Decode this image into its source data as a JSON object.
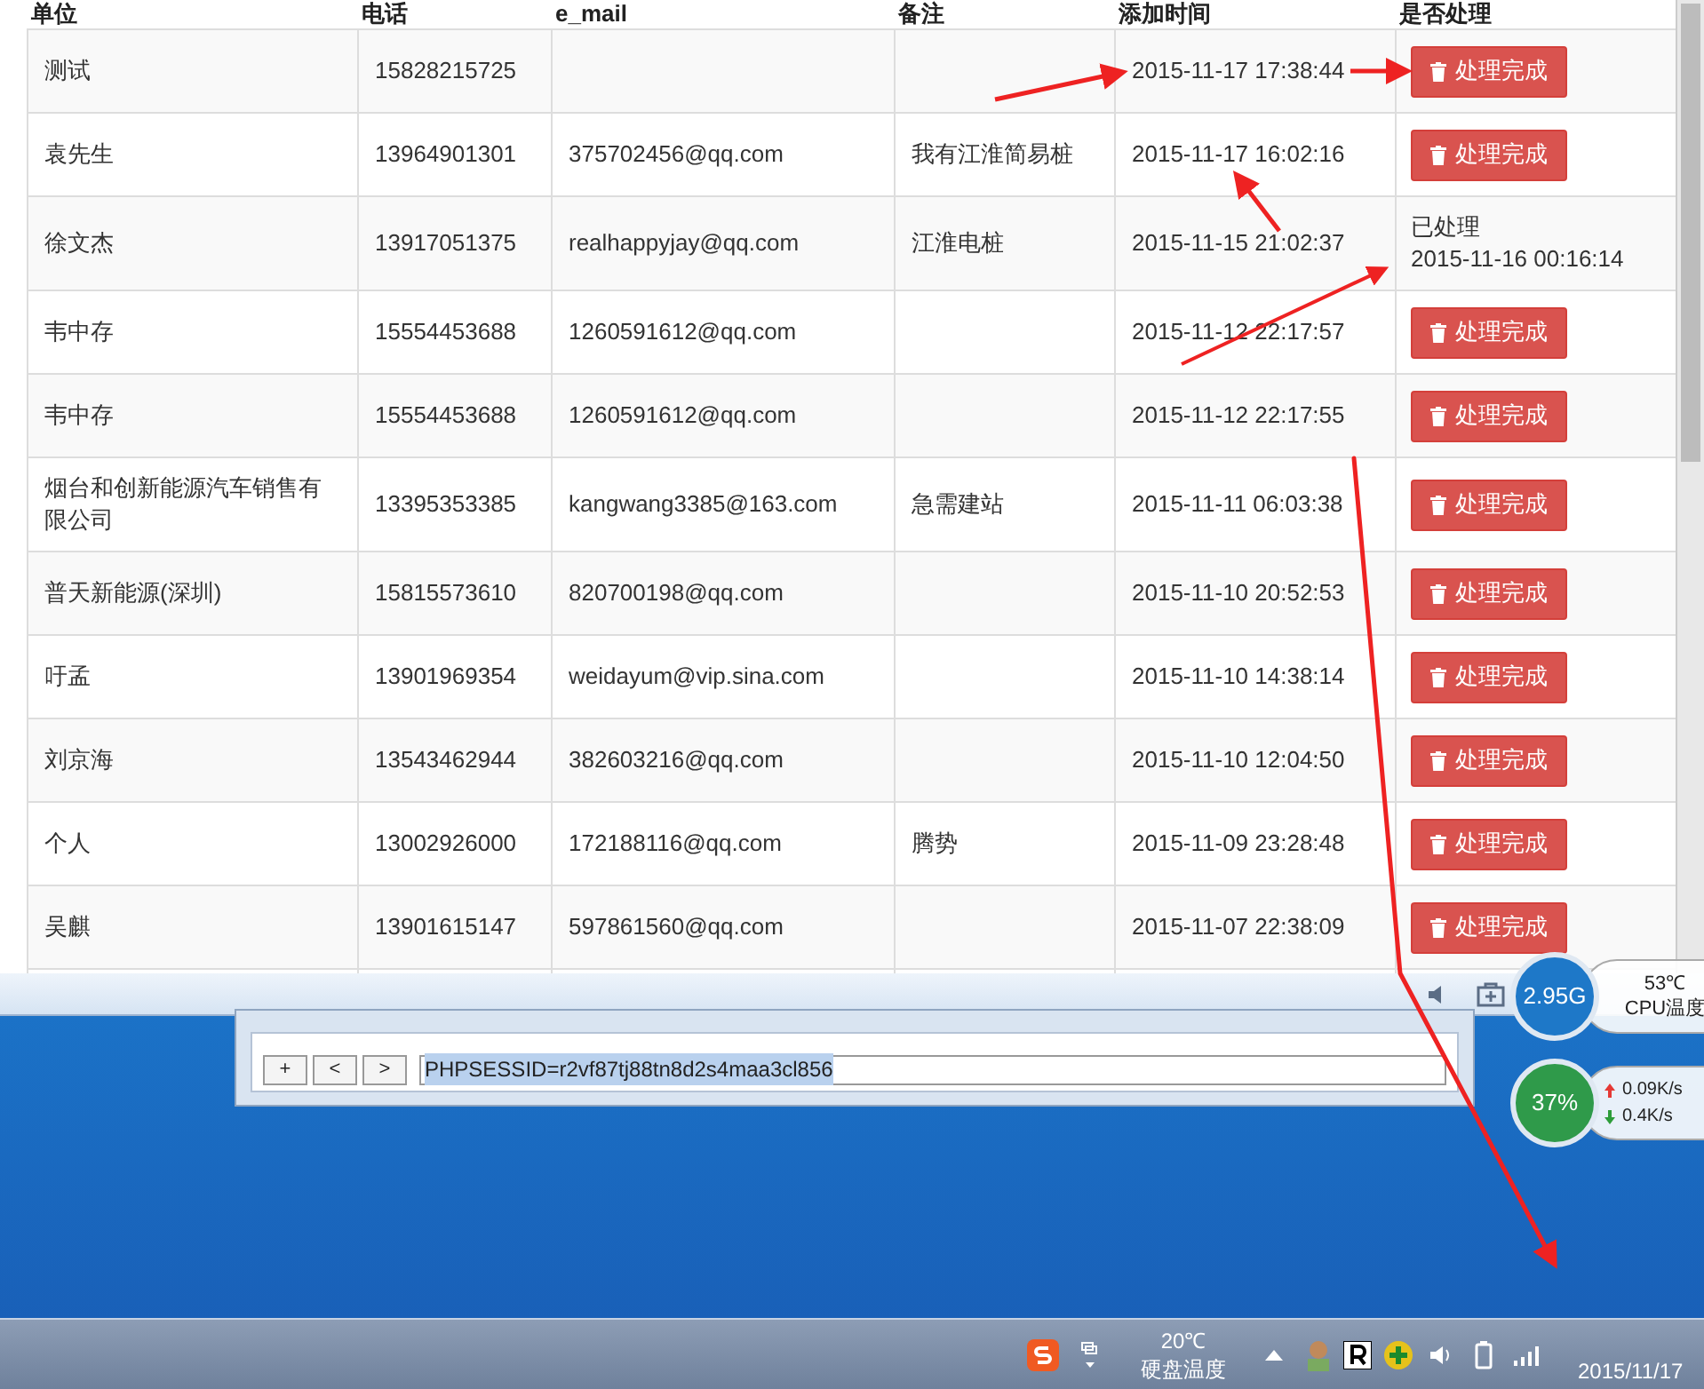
{
  "table": {
    "columns": [
      "单位",
      "电话",
      "e_mail",
      "备注",
      "添加时间",
      "是否处理"
    ],
    "rows": [
      {
        "unit": "测试",
        "phone": "15828215725",
        "email": "",
        "note": "",
        "time": "2015-11-17 17:38:44",
        "handled": false,
        "action": "处理完成"
      },
      {
        "unit": "袁先生",
        "phone": "13964901301",
        "email": "375702456@qq.com",
        "note": "我有江淮简易桩",
        "time": "2015-11-17 16:02:16",
        "handled": false,
        "action": "处理完成"
      },
      {
        "unit": "徐文杰",
        "phone": "13917051375",
        "email": "realhappyjay@qq.com",
        "note": "江淮电桩",
        "time": "2015-11-15 21:02:37",
        "handled": true,
        "status": "已处理",
        "handled_time": "2015-11-16 00:16:14"
      },
      {
        "unit": "韦中存",
        "phone": "15554453688",
        "email": "1260591612@qq.com",
        "note": "",
        "time": "2015-11-12 22:17:57",
        "handled": false,
        "action": "处理完成"
      },
      {
        "unit": "韦中存",
        "phone": "15554453688",
        "email": "1260591612@qq.com",
        "note": "",
        "time": "2015-11-12 22:17:55",
        "handled": false,
        "action": "处理完成"
      },
      {
        "unit": "烟台和创新能源汽车销售有限公司",
        "phone": "13395353385",
        "email": "kangwang3385@163.com",
        "note": "急需建站",
        "time": "2015-11-11 06:03:38",
        "handled": false,
        "action": "处理完成"
      },
      {
        "unit": "普天新能源(深圳)",
        "phone": "15815573610",
        "email": "820700198@qq.com",
        "note": "",
        "time": "2015-11-10 20:52:53",
        "handled": false,
        "action": "处理完成"
      },
      {
        "unit": "吁孟",
        "phone": "13901969354",
        "email": "weidayum@vip.sina.com",
        "note": "",
        "time": "2015-11-10 14:38:14",
        "handled": false,
        "action": "处理完成"
      },
      {
        "unit": "刘京海",
        "phone": "13543462944",
        "email": "382603216@qq.com",
        "note": "",
        "time": "2015-11-10 12:04:50",
        "handled": false,
        "action": "处理完成"
      },
      {
        "unit": "个人",
        "phone": "13002926000",
        "email": "172188116@qq.com",
        "note": "腾势",
        "time": "2015-11-09 23:28:48",
        "handled": false,
        "action": "处理完成"
      },
      {
        "unit": "吴麒",
        "phone": "13901615147",
        "email": "597861560@qq.com",
        "note": "",
        "time": "2015-11-07 22:38:09",
        "handled": false,
        "action": "处理完成"
      }
    ]
  },
  "cookie_dialog": {
    "buttons": [
      "+",
      "<",
      ">"
    ],
    "value": "PHPSESSID=r2vf87tj88tn8d2s4maa3cl856"
  },
  "cpu_gadget": {
    "usage": "2.95G",
    "temperature": "53℃",
    "label": "CPU温度"
  },
  "net_gadget": {
    "usage": "37%",
    "upload": "0.09K/s",
    "download": "0.4K/s"
  },
  "taskbar": {
    "disk_temperature": "20℃",
    "disk_label": "硬盘温度",
    "date": "2015/11/17"
  }
}
